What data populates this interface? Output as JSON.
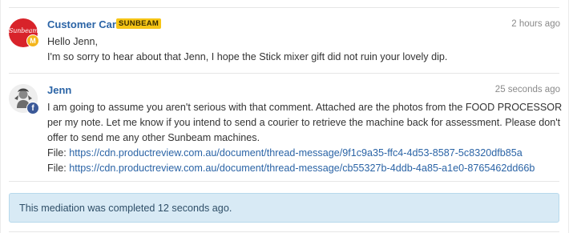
{
  "thread": {
    "messages": [
      {
        "author": "Customer Care",
        "brand_badge": "SUNBEAM",
        "avatar_text": "Sunbeam",
        "avatar_badge": "M",
        "time": "2 hours ago",
        "lines": [
          "Hello Jenn,",
          "I'm so sorry to hear about that Jenn, I hope the Stick mixer gift did not ruin your lovely dip."
        ]
      },
      {
        "author": "Jenn",
        "avatar_badge": "f",
        "time": "25 seconds ago",
        "body": "I am going to assume you aren't serious with that comment. Attached are the photos from the FOOD PROCESSOR per my note. Let me know if you intend to send a courier to retrieve the machine back for assessment. Please don't offer to send me any other Sunbeam machines.",
        "files": [
          {
            "label": "File:",
            "url": "https://cdn.productreview.com.au/document/thread-message/9f1c9a35-ffc4-4d53-8587-5c8320dfb85a"
          },
          {
            "label": "File:",
            "url": "https://cdn.productreview.com.au/document/thread-message/cb55327b-4ddb-4a85-a1e0-8765462dd66b"
          }
        ]
      }
    ],
    "notice": "This mediation was completed 12 seconds ago."
  },
  "colors": {
    "link": "#2b64a6",
    "sunbeam_red": "#d8232a",
    "badge_yellow": "#f6c516",
    "notice_bg": "#d8eaf5"
  }
}
